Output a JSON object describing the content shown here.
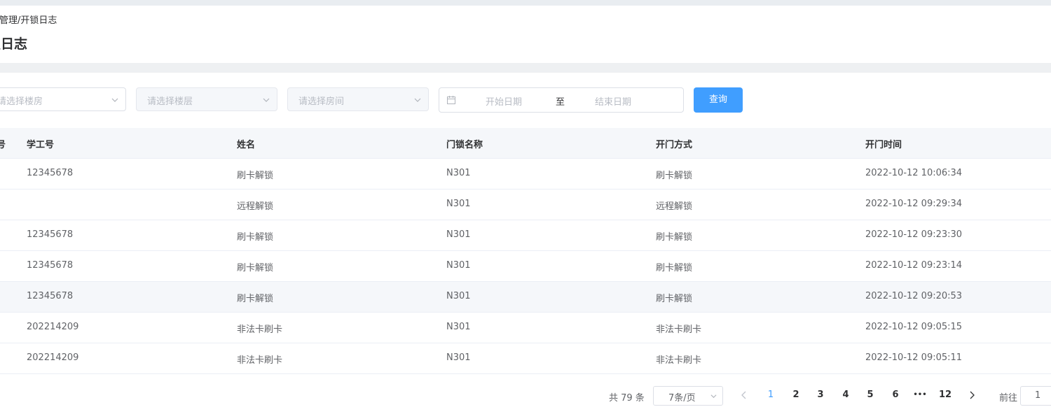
{
  "breadcrumb": "舍管理/开锁日志",
  "page_title": "锁日志",
  "filters": {
    "building_placeholder": "请选择楼房",
    "floor_placeholder": "请选择楼层",
    "room_placeholder": "请选择房间",
    "start_date_placeholder": "开始日期",
    "range_separator": "至",
    "end_date_placeholder": "结束日期",
    "query_label": "查询"
  },
  "table": {
    "headers": [
      "序号",
      "学工号",
      "姓名",
      "门锁名称",
      "开门方式",
      "开门时间"
    ],
    "rows": [
      [
        "12345678",
        "刷卡解锁",
        "N301",
        "刷卡解锁",
        "2022-10-12 10:06:34"
      ],
      [
        "",
        "远程解锁",
        "N301",
        "远程解锁",
        "2022-10-12 09:29:34"
      ],
      [
        "12345678",
        "刷卡解锁",
        "N301",
        "刷卡解锁",
        "2022-10-12 09:23:30"
      ],
      [
        "12345678",
        "刷卡解锁",
        "N301",
        "刷卡解锁",
        "2022-10-12 09:23:14"
      ],
      [
        "12345678",
        "刷卡解锁",
        "N301",
        "刷卡解锁",
        "2022-10-12 09:20:53"
      ],
      [
        "202214209",
        "非法卡刷卡",
        "N301",
        "非法卡刷卡",
        "2022-10-12 09:05:15"
      ],
      [
        "202214209",
        "非法卡刷卡",
        "N301",
        "非法卡刷卡",
        "2022-10-12 09:05:11"
      ]
    ]
  },
  "pagination": {
    "total": "共 79 条",
    "page_size": "7条/页",
    "pages": [
      "1",
      "2",
      "3",
      "4",
      "5",
      "6",
      "•••",
      "12"
    ],
    "current": "1",
    "goto_label": "前往",
    "goto_value": "1"
  },
  "colors": {
    "primary": "#409eff",
    "header_bg": "#f5f7fa",
    "border": "#ebeef5"
  }
}
